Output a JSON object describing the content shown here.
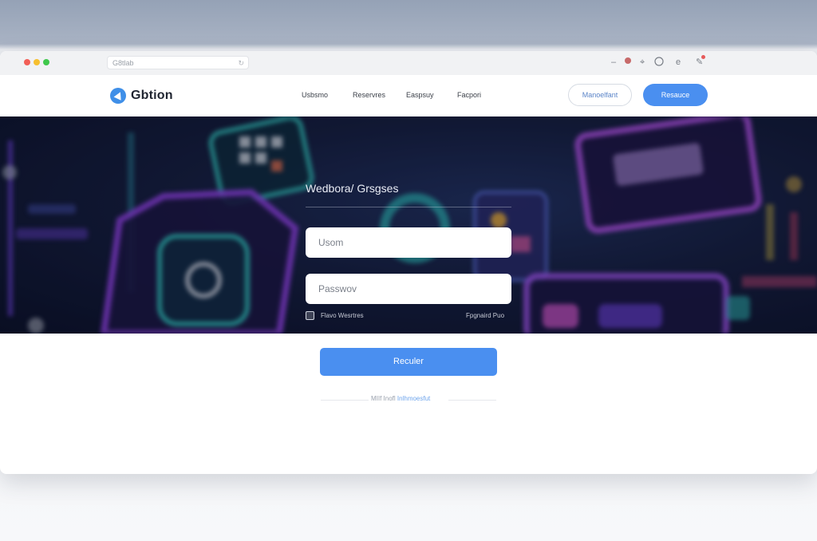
{
  "browser": {
    "address": "G8tlab",
    "toolbar_icons": [
      "minus-icon",
      "record-icon",
      "circle-icon",
      "e-icon",
      "pen-icon"
    ]
  },
  "header": {
    "brand": "Gbtion",
    "nav": [
      "Usbsmo",
      "Reservres",
      "Easpsuy",
      "Facpori"
    ],
    "secondary_button": "Manoelfant",
    "primary_button": "Resauce"
  },
  "login": {
    "title": "Wedbora/ Grsgses",
    "username_placeholder": "Usom",
    "password_placeholder": "Passwov",
    "remember_label": "Flavo Wesrtres",
    "forgot_label": "Fpgnaird Puo",
    "submit_label": "Reculer",
    "footer_prefix": "MIIf Inofl",
    "footer_link": "Inlhmoesfut"
  },
  "colors": {
    "accent": "#4a8ff0",
    "hero_bg": "#0f1630",
    "neon_purple": "#8b3fd9",
    "neon_teal": "#2fb8b0"
  }
}
